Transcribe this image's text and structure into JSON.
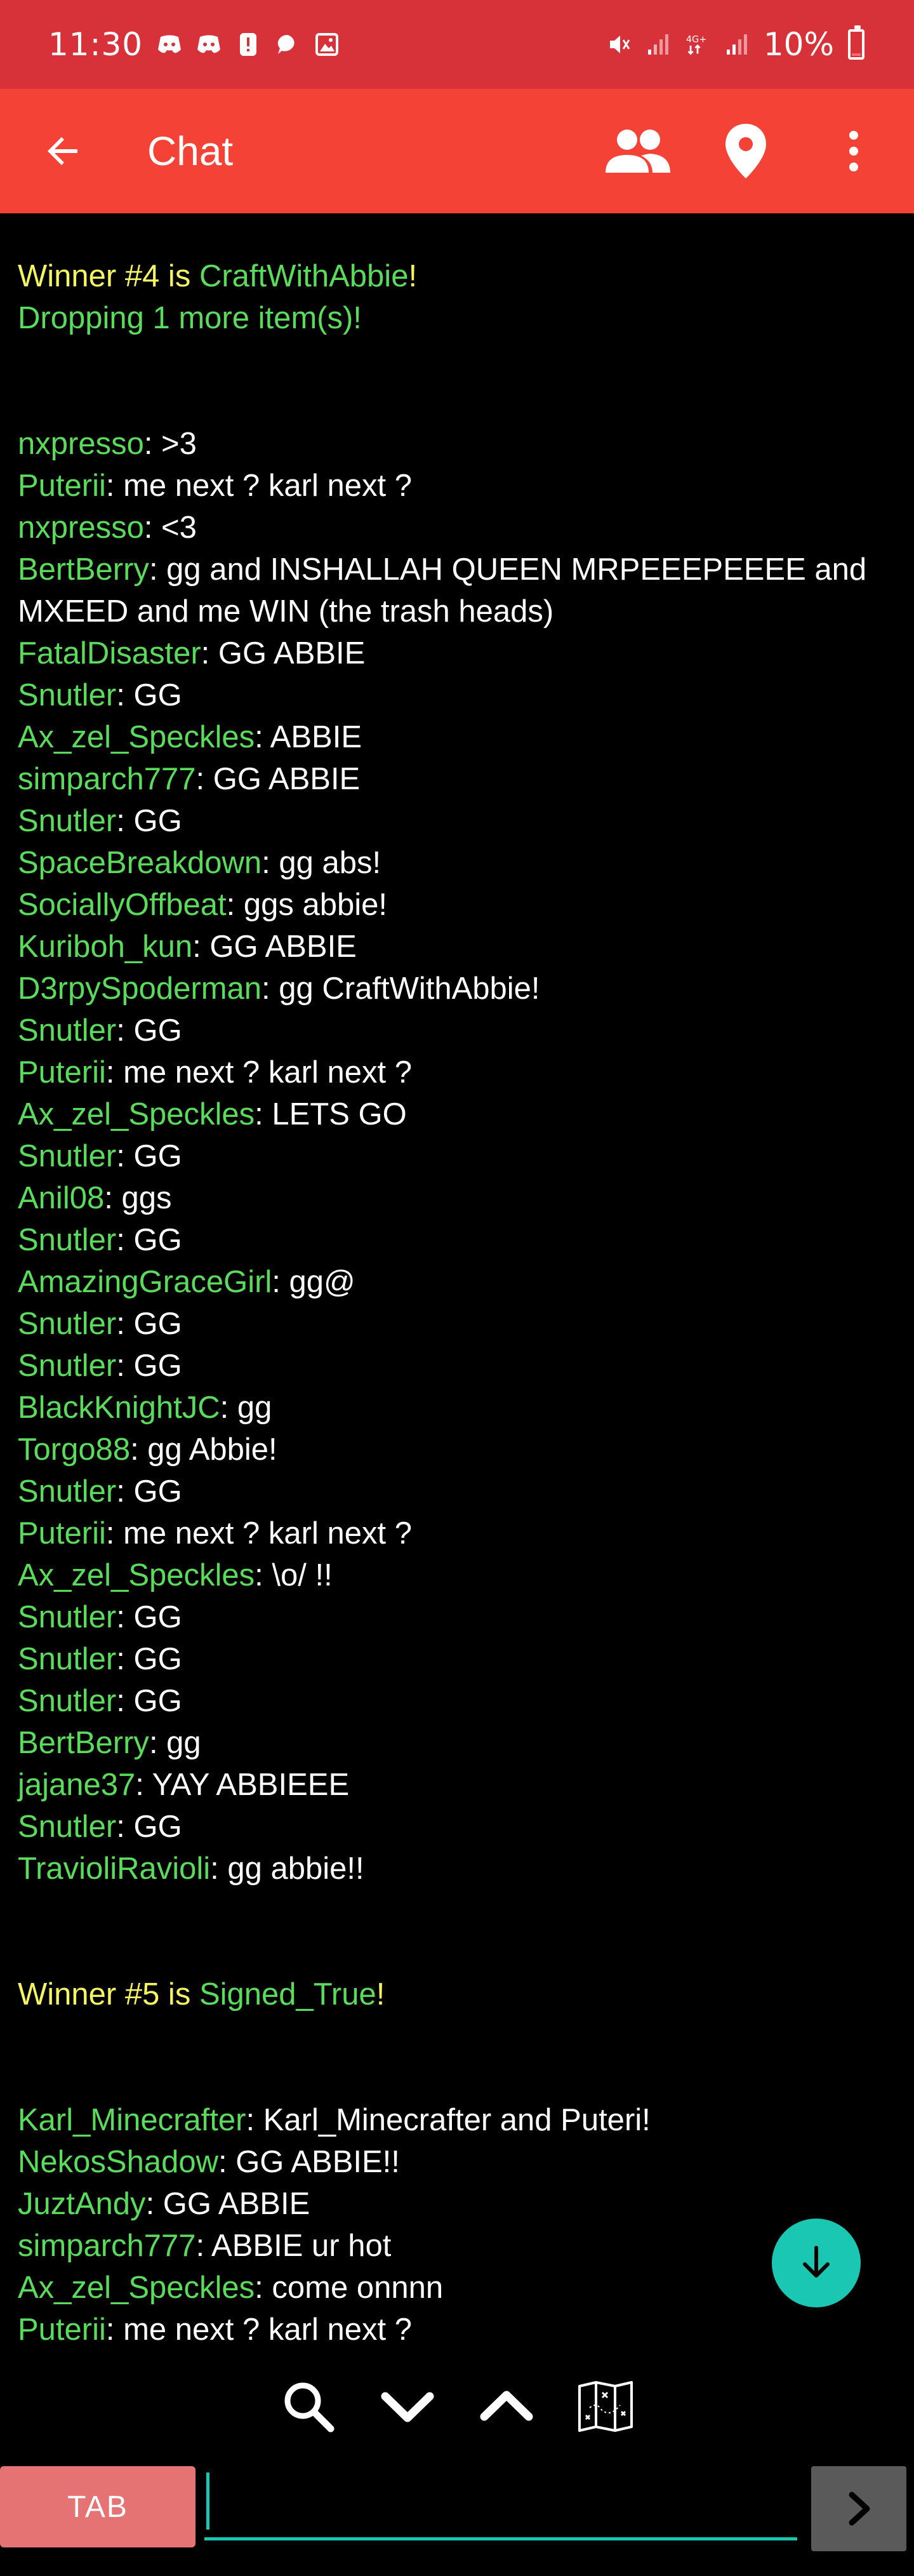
{
  "status_bar": {
    "time": "11:30",
    "battery": "10%",
    "battery_level": 0.1,
    "left_icons": [
      "discord-icon",
      "discord-icon",
      "alert-icon",
      "chat-bubble-icon",
      "image-icon"
    ],
    "right_icons": [
      "mute-icon",
      "signal-icon",
      "4g-icon",
      "signal-icon",
      "battery-icon"
    ]
  },
  "app_bar": {
    "title": "Chat",
    "actions": [
      "people-icon",
      "location-pin-icon",
      "more-vert-icon"
    ]
  },
  "colors": {
    "status_bar": "#d7323a",
    "app_bar": "#f44336",
    "username": "#5bdb5b",
    "winner": "#f5f564",
    "accent": "#1ac7b3",
    "tab_button": "#e57373",
    "send_button": "#5a5a5a"
  },
  "chat": {
    "announcement1": {
      "winner_prefix": "Winner #4 is ",
      "winner_name": "CraftWithAbbie",
      "winner_suffix": "!",
      "dropping": "Dropping 1 more item(s)!"
    },
    "messages1": [
      {
        "user": "nxpresso",
        "text": ": >3"
      },
      {
        "user": "Puterii",
        "text": ": me next ? karl next ?"
      },
      {
        "user": "nxpresso",
        "text": ": <3"
      },
      {
        "user": "BertBerry",
        "text": ": gg and INSHALLAH QUEEN MRPEEEPEEEE and MXEED and me WIN (the trash heads)"
      },
      {
        "user": "FatalDisaster",
        "text": ": GG ABBIE"
      },
      {
        "user": "Snutler",
        "text": ": GG"
      },
      {
        "user": "Ax_zel_Speckles",
        "text": ": ABBIE"
      },
      {
        "user": "simparch777",
        "text": ": GG ABBIE"
      },
      {
        "user": "Snutler",
        "text": ": GG"
      },
      {
        "user": "SpaceBreakdown",
        "text": ": gg abs!"
      },
      {
        "user": "SociallyOffbeat",
        "text": ": ggs abbie!"
      },
      {
        "user": "Kuriboh_kun",
        "text": ": GG ABBIE"
      },
      {
        "user": "D3rpySpoderman",
        "text": ": gg CraftWithAbbie!"
      },
      {
        "user": "Snutler",
        "text": ": GG"
      },
      {
        "user": "Puterii",
        "text": ": me next ? karl next ?"
      },
      {
        "user": "Ax_zel_Speckles",
        "text": ": LETS GO"
      },
      {
        "user": "Snutler",
        "text": ": GG"
      },
      {
        "user": "Anil08",
        "text": ": ggs"
      },
      {
        "user": "Snutler",
        "text": ": GG"
      },
      {
        "user": "AmazingGraceGirl",
        "text": ": gg@"
      },
      {
        "user": "Snutler",
        "text": ": GG"
      },
      {
        "user": "Snutler",
        "text": ": GG"
      },
      {
        "user": "BlackKnightJC",
        "text": ": gg"
      },
      {
        "user": "Torgo88",
        "text": ": gg Abbie!"
      },
      {
        "user": "Snutler",
        "text": ": GG"
      },
      {
        "user": "Puterii",
        "text": ": me next ? karl next ?"
      },
      {
        "user": "Ax_zel_Speckles",
        "text": ": \\o/ !!"
      },
      {
        "user": "Snutler",
        "text": ": GG"
      },
      {
        "user": "Snutler",
        "text": ": GG"
      },
      {
        "user": "Snutler",
        "text": ": GG"
      },
      {
        "user": "BertBerry",
        "text": ": gg"
      },
      {
        "user": "jajane37",
        "text": ": YAY ABBIEEE"
      },
      {
        "user": "Snutler",
        "text": ": GG"
      },
      {
        "user": "TravioliRavioli",
        "text": ": gg abbie!!"
      }
    ],
    "announcement2": {
      "winner_prefix": "Winner #5 is ",
      "winner_name": "Signed_True",
      "winner_suffix": "!"
    },
    "messages2": [
      {
        "user": "Karl_Minecrafter",
        "text": ": Karl_Minecrafter and Puteri!"
      },
      {
        "user": "NekosShadow",
        "text": ": GG ABBIE!!"
      },
      {
        "user": "JuztAndy",
        "text": ": GG ABBIE"
      },
      {
        "user": "simparch777",
        "text": ": ABBIE ur hot"
      },
      {
        "user": "Ax_zel_Speckles",
        "text": ": come onnnn"
      },
      {
        "user": "Puterii",
        "text": ": me next ? karl next ?"
      }
    ]
  },
  "fab": {
    "icon": "arrow-down-icon"
  },
  "toolbar": {
    "icons": [
      "search-icon",
      "chevron-down-icon",
      "chevron-up-icon",
      "map-icon"
    ]
  },
  "input": {
    "tab_label": "TAB",
    "value": "",
    "placeholder": "",
    "send_icon": "chevron-right-icon"
  }
}
